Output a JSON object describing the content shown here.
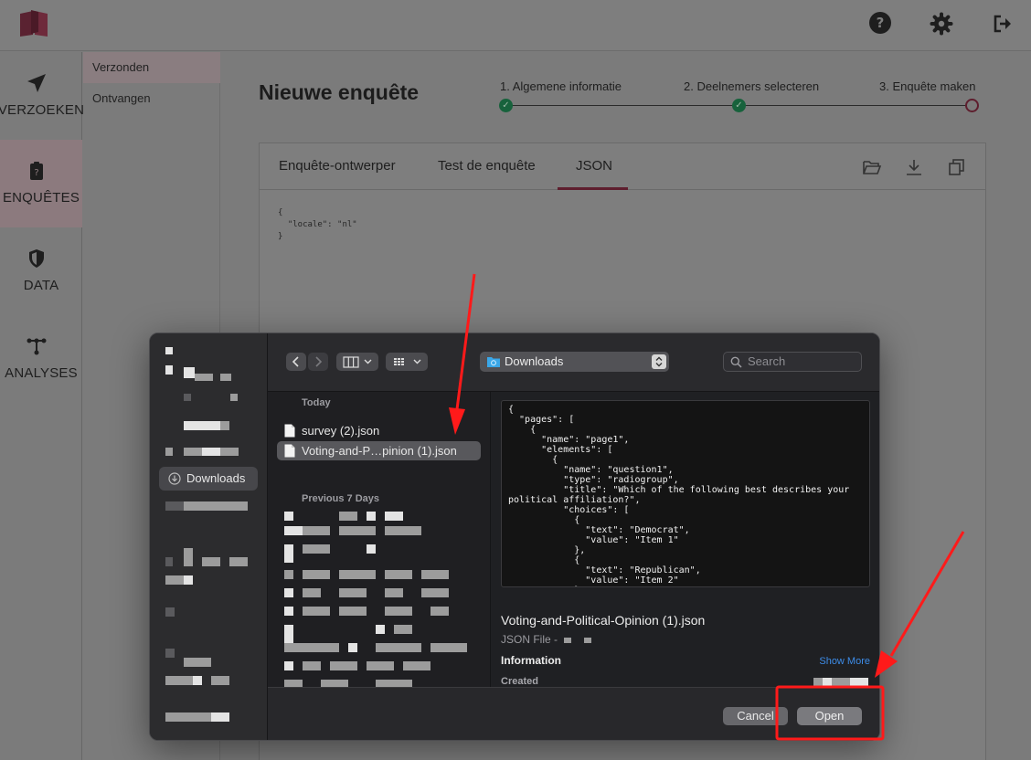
{
  "topbar": {
    "icons": [
      "logo-icon",
      "help-icon",
      "gear-icon",
      "logout-icon"
    ],
    "help_glyph": "?"
  },
  "leftnav": {
    "items": [
      {
        "label": "VERZOEKEN",
        "icon": "send-icon"
      },
      {
        "label": "ENQUÊTES",
        "icon": "clipboard-icon",
        "active": true
      },
      {
        "label": "DATA",
        "icon": "shield-icon"
      },
      {
        "label": "ANALYSES",
        "icon": "network-icon"
      }
    ]
  },
  "subnav": {
    "items": [
      {
        "label": "Verzonden",
        "active": true
      },
      {
        "label": "Ontvangen"
      }
    ]
  },
  "main": {
    "title": "Nieuwe enquête",
    "steps": [
      {
        "label": "1. Algemene informatie",
        "status": "done"
      },
      {
        "label": "2. Deelnemers selecteren",
        "status": "done"
      },
      {
        "label": "3. Enquête maken",
        "status": "current"
      }
    ],
    "tabs": [
      {
        "label": "Enquête-ontwerper"
      },
      {
        "label": "Test de enquête"
      },
      {
        "label": "JSON",
        "active": true
      }
    ],
    "toolbar_icons": [
      "folder-open-icon",
      "download-icon",
      "copy-icon"
    ],
    "json_text": "{\n  \"locale\": \"nl\"\n}"
  },
  "dialog": {
    "location": "Downloads",
    "search_placeholder": "Search",
    "sidebar_selected": "Downloads",
    "sections": {
      "today": "Today",
      "previous": "Previous 7 Days"
    },
    "files_today": [
      {
        "name": "survey (2).json"
      },
      {
        "name": "Voting-and-P…pinion (1).json",
        "selected": true
      }
    ],
    "preview_code": "{\n  \"pages\": [\n    {\n      \"name\": \"page1\",\n      \"elements\": [\n        {\n          \"name\": \"question1\",\n          \"type\": \"radiogroup\",\n          \"title\": \"Which of the following best describes your\npolitical affiliation?\",\n          \"choices\": [\n            {\n              \"text\": \"Democrat\",\n              \"value\": \"Item 1\"\n            },\n            {\n              \"text\": \"Republican\",\n              \"value\": \"Item 2\"\n            },",
    "preview": {
      "name": "Voting-and-Political-Opinion (1).json",
      "kind": "JSON File -",
      "info_heading": "Information",
      "show_more": "Show More",
      "created_label": "Created"
    },
    "buttons": {
      "cancel": "Cancel",
      "open": "Open"
    }
  },
  "annotations": {
    "color": "#ff1a1a"
  }
}
